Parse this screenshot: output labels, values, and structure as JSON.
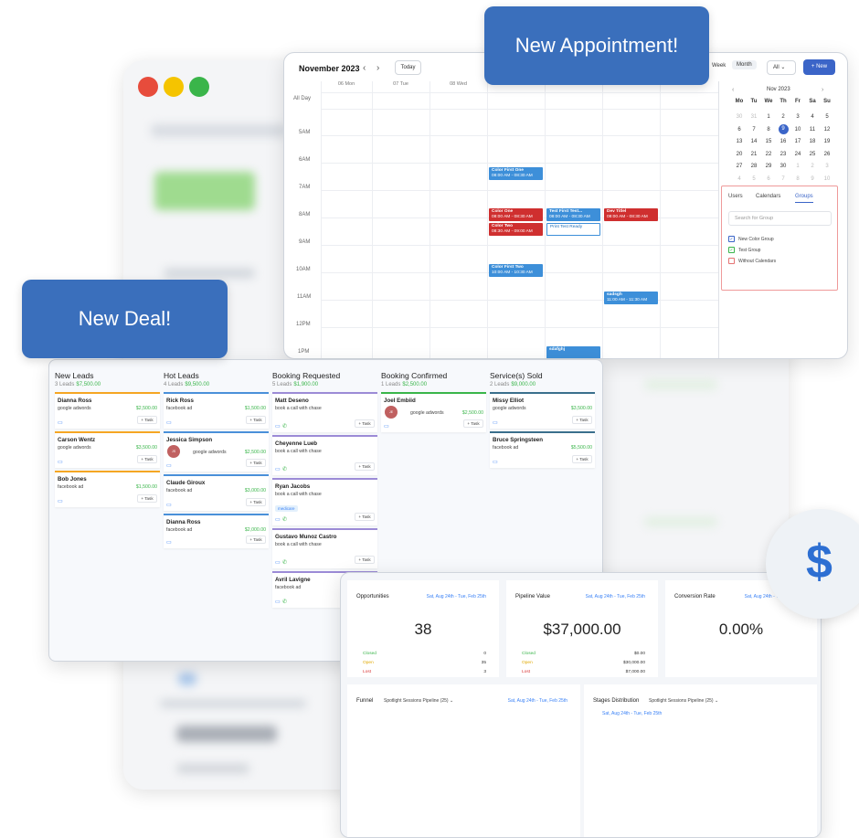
{
  "banners": {
    "appointment": "New Appointment!",
    "deal": "New Deal!"
  },
  "calendar": {
    "title": "November 2023",
    "today_label": "Today",
    "views": [
      "Week",
      "Month"
    ],
    "filter_value": "All",
    "new_label": "+ New",
    "day_headers": [
      "06 Mon",
      "07 Tue",
      "08 Wed",
      "09 Thu",
      "10 Fri",
      "11 Sat",
      "12 Sun"
    ],
    "time_labels": [
      "All Day",
      "5AM",
      "6AM",
      "7AM",
      "8AM",
      "9AM",
      "10AM",
      "11AM",
      "12PM",
      "1PM"
    ],
    "events": [
      {
        "title": "Color First One",
        "time": "08:00 AM - 08:30 AM"
      },
      {
        "title": "Color One",
        "time": "08:00 AM - 08:30 AM"
      },
      {
        "title": "Color Two",
        "time": "08:30 AM - 09:00 AM"
      },
      {
        "title": "Test First Test...",
        "time": "08:00 AM - 08:30 AM"
      },
      {
        "title": "Print Test Ready",
        "time": ""
      },
      {
        "title": "Dev Titlel",
        "time": "08:00 AM - 08:30 AM"
      },
      {
        "title": "Color First Two",
        "time": "10:00 AM - 10:30 AM"
      },
      {
        "title": "sadsgh",
        "time": "11:00 AM - 11:30 AM"
      },
      {
        "title": "sdafghj",
        "time": ""
      }
    ],
    "mini": {
      "month": "Nov 2023",
      "weekdays": [
        "Mo",
        "Tu",
        "We",
        "Th",
        "Fr",
        "Sa",
        "Su"
      ],
      "weeks": [
        [
          "30",
          "31",
          "1",
          "2",
          "3",
          "4",
          "5"
        ],
        [
          "6",
          "7",
          "8",
          "9",
          "10",
          "11",
          "12"
        ],
        [
          "13",
          "14",
          "15",
          "16",
          "17",
          "18",
          "19"
        ],
        [
          "20",
          "21",
          "22",
          "23",
          "24",
          "25",
          "26"
        ],
        [
          "27",
          "28",
          "29",
          "30",
          "1",
          "2",
          "3"
        ],
        [
          "4",
          "5",
          "6",
          "7",
          "8",
          "9",
          "10"
        ]
      ],
      "selected": "9"
    },
    "panel": {
      "tabs": [
        "Users",
        "Calendars",
        "Groups"
      ],
      "active_tab": "Groups",
      "search_placeholder": "Search for Group",
      "options": [
        {
          "label": "New Color Group",
          "checked": true
        },
        {
          "label": "Test Group",
          "checked": true
        },
        {
          "label": "Without Calendars",
          "checked": false
        }
      ]
    }
  },
  "pipeline": {
    "task_label": "+ Task",
    "stages": [
      {
        "name": "New Leads",
        "count": "3 Leads",
        "amount": "$7,500.00",
        "color": "#f5a623",
        "cards": [
          {
            "name": "Dianna Ross",
            "source": "google adwords",
            "value": "$2,500.00"
          },
          {
            "name": "Carson Wentz",
            "source": "google adwords",
            "value": "$3,500.00"
          },
          {
            "name": "Bob Jones",
            "source": "facebook ad",
            "value": "$1,500.00"
          }
        ]
      },
      {
        "name": "Hot Leads",
        "count": "4 Leads",
        "amount": "$9,500.00",
        "color": "#4a90d9",
        "cards": [
          {
            "name": "Rick Ross",
            "source": "facebook ad",
            "value": "$1,500.00"
          },
          {
            "name": "Jessica Simpson",
            "source": "google adwords",
            "value": "$2,500.00",
            "avatar": "JS"
          },
          {
            "name": "Claude Giroux",
            "source": "facebook ad",
            "value": "$3,000.00"
          },
          {
            "name": "Dianna Ross",
            "source": "facebook ad",
            "value": "$2,000.00"
          }
        ]
      },
      {
        "name": "Booking Requested",
        "count": "5 Leads",
        "amount": "$1,900.00",
        "color": "#9c8bd6",
        "cards": [
          {
            "name": "Matt Deseno",
            "source": "book a call with chase"
          },
          {
            "name": "Cheyenne Lueb",
            "source": "book a call with chase"
          },
          {
            "name": "Ryan Jacobs",
            "source": "book a call with chase",
            "tag": "medicare"
          },
          {
            "name": "Gustavo Munoz Castro",
            "source": "book a call with chase"
          },
          {
            "name": "Avril Lavigne",
            "source": "facebook ad"
          }
        ]
      },
      {
        "name": "Booking Confirmed",
        "count": "1 Leads",
        "amount": "$2,500.00",
        "color": "#3ab54a",
        "cards": [
          {
            "name": "Joel Embiid",
            "source": "google adwords",
            "value": "$2,500.00",
            "avatar": "JE"
          }
        ]
      },
      {
        "name": "Service(s) Sold",
        "count": "2 Leads",
        "amount": "$9,000.00",
        "color": "#3a6f8c",
        "cards": [
          {
            "name": "Missy Elliot",
            "source": "google adwords",
            "value": "$3,500.00"
          },
          {
            "name": "Bruce Springsteen",
            "source": "facebook ad",
            "value": "$5,500.00"
          }
        ]
      }
    ]
  },
  "dashboard": {
    "date_range": "Sat, Aug 24th - Tue, Feb 25th",
    "opportunities": {
      "title": "Opportunities",
      "value": "38",
      "stats": [
        {
          "label": "Closed",
          "value": "0"
        },
        {
          "label": "Open",
          "value": "35"
        },
        {
          "label": "Lost",
          "value": "3"
        }
      ]
    },
    "pipeline_value": {
      "title": "Pipeline Value",
      "value": "$37,000.00",
      "stats": [
        {
          "label": "Closed",
          "value": "$0.00"
        },
        {
          "label": "Open",
          "value": "$30,000.00"
        },
        {
          "label": "Lost",
          "value": "$7,000.00"
        }
      ]
    },
    "conversion": {
      "title": "Conversion Rate",
      "value": "0.00%"
    },
    "funnel": {
      "title": "Funnel",
      "pipeline": "Spotlight Sessions Pipeline (25)"
    },
    "stages": {
      "title": "Stages Distribution",
      "pipeline": "Spotlight Sessions Pipeline (25)"
    },
    "dollar_icon": "$"
  }
}
